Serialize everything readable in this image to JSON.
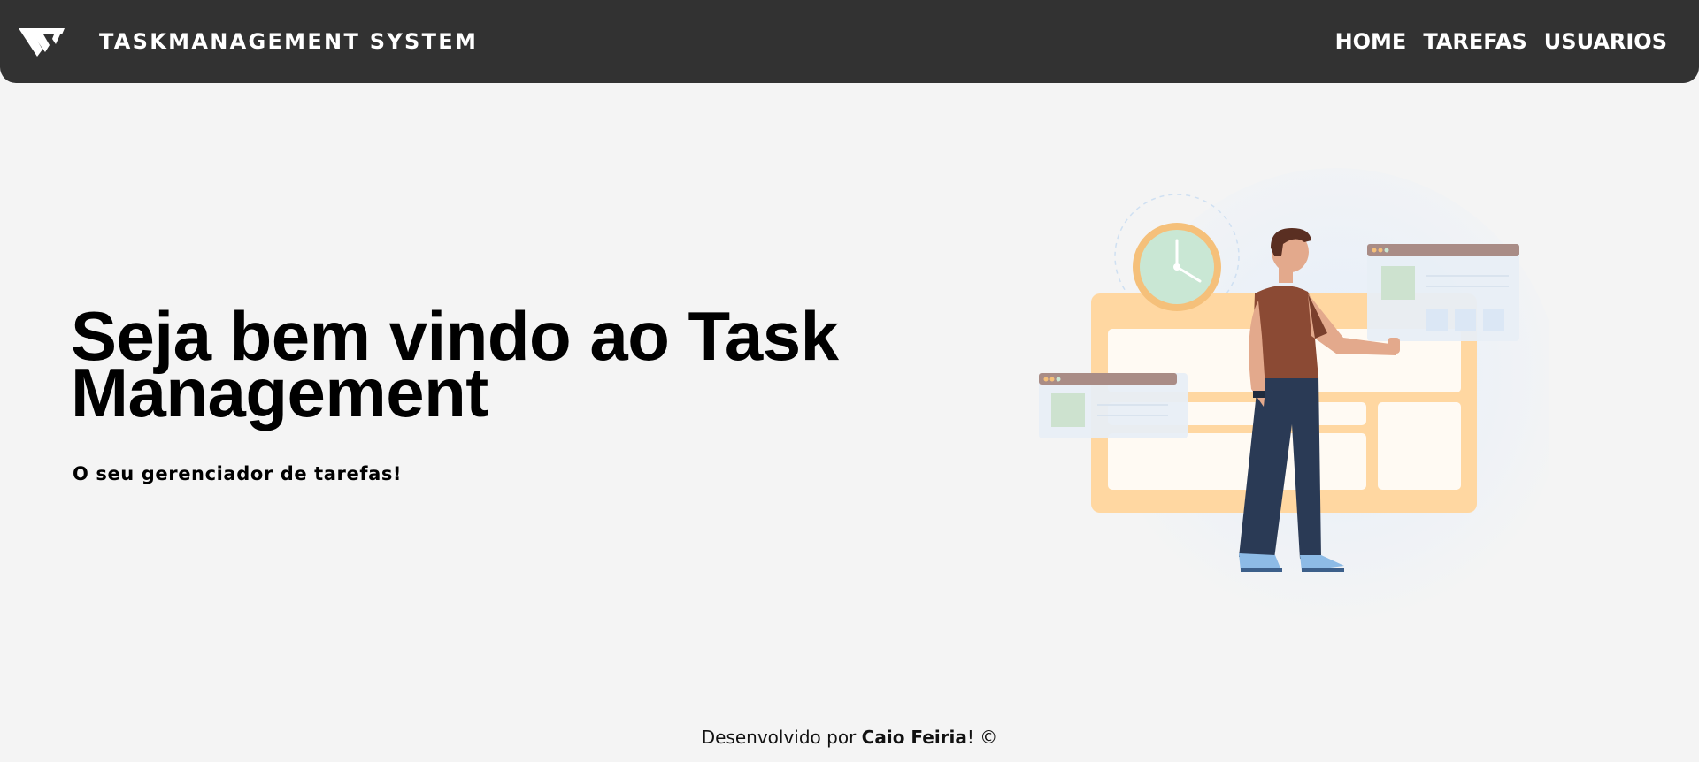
{
  "header": {
    "brand": "TASKMANAGEMENT SYSTEM",
    "logo_icon": "tm-logo-icon",
    "nav": [
      {
        "label": "HOME"
      },
      {
        "label": "TAREFAS"
      },
      {
        "label": "USUARIOS"
      }
    ]
  },
  "hero": {
    "title": "Seja bem vindo ao Task Management",
    "subtitle": "O seu gerenciador de tarefas!",
    "illustration_icon": "person-task-board-illustration"
  },
  "footer": {
    "prefix": "Desenvolvido por ",
    "author": "Caio Feiria",
    "suffix": "! ©"
  },
  "colors": {
    "navbar_bg": "#323232",
    "page_bg": "#f4f4f4",
    "text": "#000000"
  }
}
